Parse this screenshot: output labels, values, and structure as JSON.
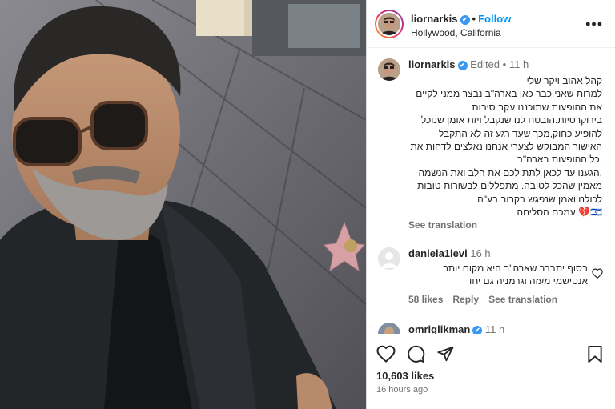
{
  "post": {
    "username": "liornarkis",
    "follow_label": "Follow",
    "location": "Hollywood, California",
    "more_label": "•••"
  },
  "caption": {
    "username": "liornarkis",
    "edited": "Edited",
    "time": "11 h",
    "text": "קהל אהוב ויקר שלי\nלמרות שאני כבר כאן בארה\"ב נבצר ממני לקיים\nאת ההופעות שתוכננו עקב סיבות\nבירוקרטיות.הובטח לנו שנקבל ויזת אומן שנוכל\nלהופיע כחוק,מכך שעד רגע זה לא התקבל\nהאישור המבוקש לצערי אנחנו נאלצים לדחות את\n.כל ההופעות בארה\"ב\n.הגענו עד לכאן לתת לכם את הלב ואת הנשמה\nמאמין שהכל לטובה. מתפללים לבשורות טובות\nלכולנו ואמן שנפגש בקרוב בע\"ה\n🇮🇱💔.עמכם הסליחה",
    "see_translation": "See translation"
  },
  "comments": [
    {
      "username": "daniela1levi",
      "time": "16 h",
      "text": "בסוף יתברר שארה\"ב היא מקום יותר\nאנטישמי מעזה וגרמניה גם יחד",
      "likes": "58 likes",
      "reply": "Reply",
      "see_translation": "See translation"
    },
    {
      "username": "omriglikman",
      "time": "11 h"
    }
  ],
  "footer": {
    "likes": "10,603 likes",
    "ago": "16 hours ago"
  },
  "icons": {
    "verified": "verified-badge-icon",
    "like": "heart-icon",
    "comment": "comment-icon",
    "share": "send-icon",
    "save": "bookmark-icon"
  },
  "colors": {
    "accent": "#0095f6",
    "verified": "#3897f0",
    "secondary_text": "#737373"
  }
}
